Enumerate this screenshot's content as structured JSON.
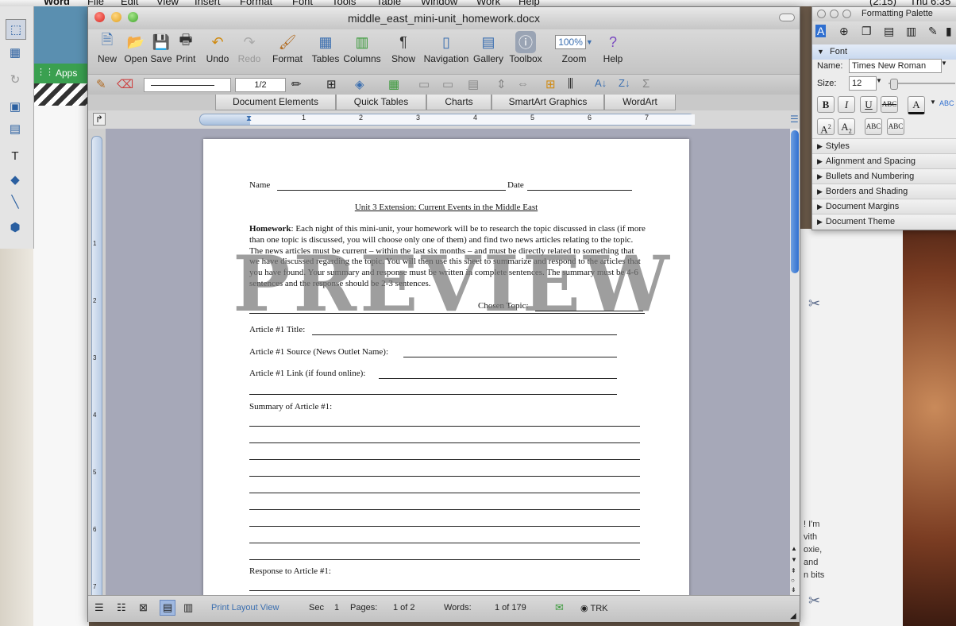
{
  "menubar": {
    "items": [
      "Word",
      "File",
      "Edit",
      "View",
      "Insert",
      "Format",
      "Font",
      "Tools",
      "Table",
      "Window",
      "Work",
      "Help"
    ],
    "clock": "Thu 6:35",
    "battery": "(2:15)"
  },
  "browser": {
    "apps_label": "Apps"
  },
  "window": {
    "title": "middle_east_mini-unit_homework.docx"
  },
  "toolbar": {
    "new": "New",
    "open": "Open",
    "save": "Save",
    "print": "Print",
    "undo": "Undo",
    "redo": "Redo",
    "format": "Format",
    "tables": "Tables",
    "columns": "Columns",
    "show": "Show",
    "navigation": "Navigation",
    "gallery": "Gallery",
    "toolbox": "Toolbox",
    "zoom_value": "100%",
    "zoom": "Zoom",
    "help": "Help",
    "line_weight": "1/2",
    "show_icon": "¶"
  },
  "ribbon": {
    "tabs": [
      "Document Elements",
      "Quick Tables",
      "Charts",
      "SmartArt Graphics",
      "WordArt"
    ]
  },
  "ruler": {
    "h_marks": [
      "1",
      "2",
      "3",
      "4",
      "5",
      "6",
      "7"
    ],
    "v_marks": [
      "1",
      "2",
      "3",
      "4",
      "5",
      "6",
      "7"
    ]
  },
  "document": {
    "name_label": "Name",
    "date_label": "Date",
    "heading": "Unit 3 Extension: Current Events in the Middle East",
    "homework_bold": "Homework",
    "homework_text": ": Each night of this mini-unit, your homework will be to research the topic discussed in class (if more than one topic is discussed, you will choose only one of them) and find two news articles relating to the topic. The news articles must be current – within the last six months – and must be directly related to something that we have discussed regarding the topic. You will then use this sheet to summarize and respond to the articles that you have found. Your summary and response must be written in complete sentences. The summary must be 4-6 sentences and the response should be 2-3 sentences.",
    "chosen_topic": "Chosen Topic:",
    "article_title": "Article #1 Title:",
    "article_source": "Article #1 Source (News Outlet Name):",
    "article_link": "Article #1 Link (if found online):",
    "summary_label": "Summary of Article #1:",
    "response_label": "Response to Article #1:",
    "watermark": "PREVIEW"
  },
  "status": {
    "view": "Print Layout View",
    "sec_label": "Sec",
    "sec": "1",
    "pages_label": "Pages:",
    "pages": "1 of 2",
    "words_label": "Words:",
    "words": "1 of 179",
    "trk": "TRK"
  },
  "palette": {
    "title": "Formatting Palette",
    "font_section": "Font",
    "name_label": "Name:",
    "font_name": "Times New Roman",
    "size_label": "Size:",
    "font_size": "12",
    "bold": "B",
    "italic": "I",
    "underline": "U",
    "strike": "ABC",
    "superscript": "A",
    "superscript_mark": "2",
    "subscript": "A",
    "subscript_mark": "2",
    "smallcaps": "ABC",
    "allcaps": "ABC",
    "font_color": "A",
    "sections": [
      "Styles",
      "Alignment and Spacing",
      "Bullets and Numbering",
      "Borders and Shading",
      "Document Margins",
      "Document Theme"
    ]
  },
  "side_text": {
    "lines": [
      "! I'm",
      "vith",
      "oxie,",
      "and",
      "n bits"
    ]
  },
  "colors": {
    "accent": "#3b6fb0",
    "watermark": "#8c8c8c"
  }
}
